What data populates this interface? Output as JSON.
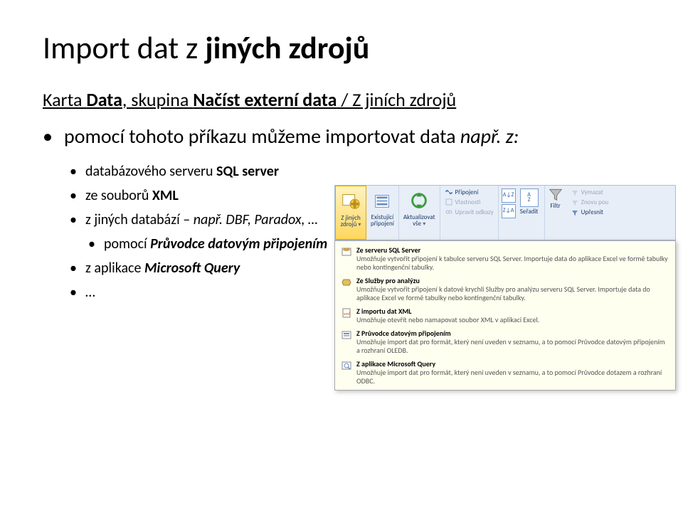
{
  "heading": {
    "pre": "Import dat z ",
    "bold": "jiných zdrojů"
  },
  "subtitle": {
    "pre": "Karta ",
    "b1": "Data",
    "mid": ", skupina ",
    "b2": "Načíst externí data",
    "post": " / Z jiních zdrojů"
  },
  "main_bullet": {
    "pre": "pomocí tohoto příkazu můžeme importovat data ",
    "i1": "např. z:"
  },
  "subs": {
    "s1_pre": "databázového serveru ",
    "s1_b": "SQL server",
    "s2_pre": "ze souborů ",
    "s2_b": "XML",
    "s3_pre": "z jiných databází – ",
    "s3_i": "např. DBF, Paradox, …",
    "s4_pre": "pomocí ",
    "s4_bi": "Průvodce datovým připojením",
    "s5_pre": "z aplikace  ",
    "s5_bi": "Microsoft Query",
    "s6": "…"
  },
  "ribbon": {
    "btn1_l1": "Z jiných",
    "btn1_l2": "zdrojů",
    "btn2_l1": "Existující",
    "btn2_l2": "připojení",
    "btn3_l1": "Aktualizovat",
    "btn3_l2": "vše",
    "conn_r1": "Připojení",
    "conn_r2": "Vlastnosti",
    "conn_r3": "Upravit odkazy",
    "sort_az": "A↓Z",
    "sort_za": "Z↓A",
    "sort_lbl": "Seřadit",
    "filter_lbl": "Filtr",
    "clr_r1": "Vymazat",
    "clr_r2": "Znovu pou",
    "clr_r3": "Upřesnit",
    "drop": "▾"
  },
  "tooltip": {
    "t1": "Ze serveru SQL Server",
    "d1": "Umožňuje vytvořit připojení k tabulce serveru SQL Server. Importuje data do aplikace Excel ve formě tabulky nebo kontingenční tabulky.",
    "t2": "Ze Služby pro analýzu",
    "d2": "Umožňuje vytvořit připojení k datové krychli Služby pro analýzu serveru SQL Server. Importuje data do aplikace Excel ve formě tabulky nebo kontingenční tabulky.",
    "t3": "Z importu dat XML",
    "d3": "Umožňuje otevřít nebo namapovat soubor XML v aplikaci Excel.",
    "t4": "Z Průvodce datovým připojením",
    "d4": "Umožňuje import dat pro formát, který není uveden v seznamu, a to pomocí Průvodce datovým připojením a rozhraní OLEDB.",
    "t5": "Z aplikace Microsoft Query",
    "d5": "Umožňuje import dat pro formát, který není uveden v seznamu, a to pomocí Průvodce dotazem a rozhraní ODBC."
  }
}
